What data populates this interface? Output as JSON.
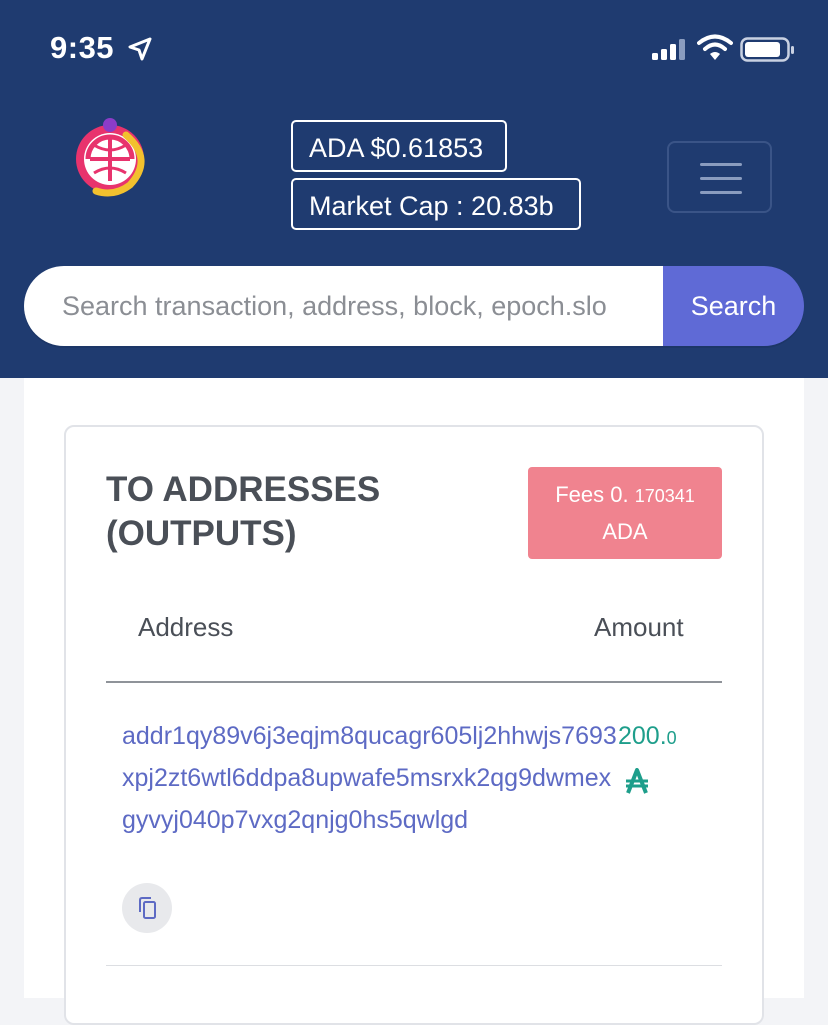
{
  "status_bar": {
    "time": "9:35"
  },
  "header": {
    "ada_price": "ADA $0.61853",
    "market_cap": "Market Cap : 20.83b"
  },
  "search": {
    "placeholder": "Search transaction, address, block, epoch.slo",
    "button_label": "Search"
  },
  "outputs": {
    "title": "TO ADDRESSES (OUTPUTS)",
    "fees_prefix": "Fees 0.",
    "fees_value": "170341",
    "fees_unit": "ADA",
    "columns": {
      "address": "Address",
      "amount": "Amount"
    },
    "rows": [
      {
        "address": "addr1qy89v6j3eqjm8qucagr605lj2hhwjs7693xpj2zt6wtl6ddpa8upwafe5msrxk2qg9dwmexgyvyj040p7vxg2qnjg0hs5qwlgd",
        "amount_int": "200.",
        "amount_dec": "0"
      }
    ]
  },
  "colors": {
    "header_bg": "#1f3b70",
    "search_button": "#5f6ad6",
    "fees_badge": "#f0838f",
    "address_link": "#5d6ac4",
    "amount": "#1e9e8b"
  }
}
